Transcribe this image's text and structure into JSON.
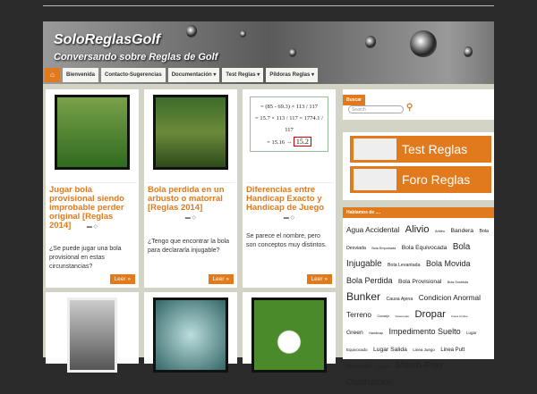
{
  "site": {
    "logo": "SoloReglasGolf",
    "tagline": "Conversando sobre Reglas de Golf"
  },
  "nav": {
    "home_icon": "home-icon",
    "items": [
      "Bienvenida",
      "Contacto-Sugerencias",
      "Documentación ▾",
      "Test Reglas ▾",
      "Píldoras Reglas ▾"
    ]
  },
  "posts": [
    {
      "title": "Jugar bola provisional siendo improbable perder original [Reglas 2014]",
      "excerpt": "¿Se puede jugar una bola provisional en estas circunstancias?",
      "read": "Leer »"
    },
    {
      "title": "Bola perdida en un arbusto o matorral [Reglas 2014]",
      "excerpt": "¿Tengo que encontrar la bola para declararla injugable?",
      "read": "Leer »"
    },
    {
      "title": "Diferencias entre Handicap Exacto y Handicap de Juego",
      "excerpt": "Se parece el nombre, pero son conceptos muy distintos.",
      "read": "Leer »"
    }
  ],
  "formula": {
    "l1": "= (85 - 69.3) × 113 / 117",
    "l2": "= 15.7 × 113 / 117 = 1774.1 / 117",
    "l3": "= 15.16 → ",
    "result": "15.2"
  },
  "sidebar": {
    "search_title": "Buscar",
    "search_placeholder": "Search",
    "test": "Test Reglas",
    "foro": "Foro Reglas",
    "tags_title": "Hablamos de ....",
    "tags": [
      [
        "Agua Accidental",
        11
      ],
      [
        "Alivio",
        15
      ],
      [
        "Arbitro",
        5
      ],
      [
        "Bandera",
        9
      ],
      [
        "Bola Desviada",
        7
      ],
      [
        "Bola Empotrada",
        5
      ],
      [
        "Bola Equivocada",
        9
      ],
      [
        "Bola Injugable",
        13
      ],
      [
        "Bola Levantada",
        7
      ],
      [
        "Bola Movida",
        12
      ],
      [
        "Bola Perdida",
        12
      ],
      [
        "Bola Provisional",
        9
      ],
      [
        "Bola Sustituta",
        5
      ],
      [
        "Bunker",
        16
      ],
      [
        "Causa Ajena",
        7
      ],
      [
        "Condicion Anormal Terreno",
        11
      ],
      [
        "Consejo",
        5
      ],
      [
        "Desempate",
        4
      ],
      [
        "Dropar",
        15
      ],
      [
        "Fuera Limites",
        4
      ],
      [
        "Green",
        9
      ],
      [
        "Handicap",
        5
      ],
      [
        "Impedimento Suelto",
        12
      ],
      [
        "Lugar Equivocado",
        6
      ],
      [
        "Lugar Salida",
        9
      ],
      [
        "Linea Juego",
        6
      ],
      [
        "Linea Putt",
        8
      ],
      [
        "Marcador",
        9
      ],
      [
        "Marcar",
        6
      ],
      [
        "Match-Play",
        14
      ],
      [
        "Obstruccion",
        13
      ]
    ]
  }
}
